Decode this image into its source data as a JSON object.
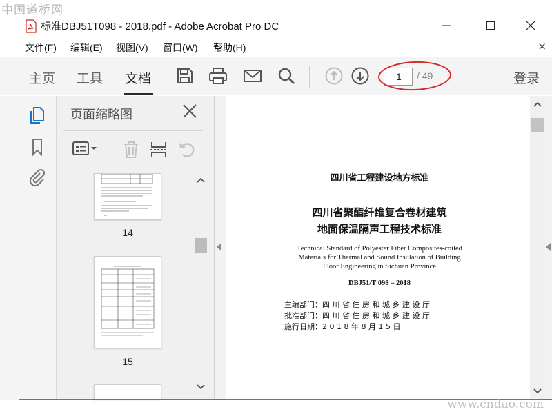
{
  "watermark": {
    "top": "中国道桥网",
    "bottom": "www.cndao.com"
  },
  "window": {
    "title": "标准DBJ51T098 - 2018.pdf - Adobe Acrobat Pro DC"
  },
  "menu": {
    "items": [
      "文件(F)",
      "编辑(E)",
      "视图(V)",
      "窗口(W)",
      "帮助(H)"
    ],
    "close": "×"
  },
  "toolbar": {
    "tabs": [
      "主页",
      "工具",
      "文档"
    ],
    "active_tab": "文档",
    "page_current": "1",
    "page_total": "/ 49",
    "login": "登录",
    "highlight_color": "#d62a2a"
  },
  "thumbnails_panel": {
    "title": "页面缩略图",
    "pages": [
      {
        "number": "14"
      },
      {
        "number": "15"
      }
    ]
  },
  "document": {
    "org": "四川省工程建设地方标准",
    "title_cn_1": "四川省聚酯纤维复合卷材建筑",
    "title_cn_2": "地面保温隔声工程技术标准",
    "title_en": [
      "Technical Standard of Polyester Fiber Composites-coiled",
      "Materials for Thermal and Sound Insulation of Building",
      "Floor Engineering in Sichuan Province"
    ],
    "code": "DBJ51/T 098 – 2018",
    "meta": [
      {
        "label": "主编部门：",
        "value": "四  川  省  住  房  和  城  乡  建  设  厅"
      },
      {
        "label": "批准部门：",
        "value": "四  川  省  住  房  和  城  乡  建  设  厅"
      },
      {
        "label": "施行日期：",
        "value": "2  0  1  8    年    8    月    1  5    日"
      }
    ]
  }
}
